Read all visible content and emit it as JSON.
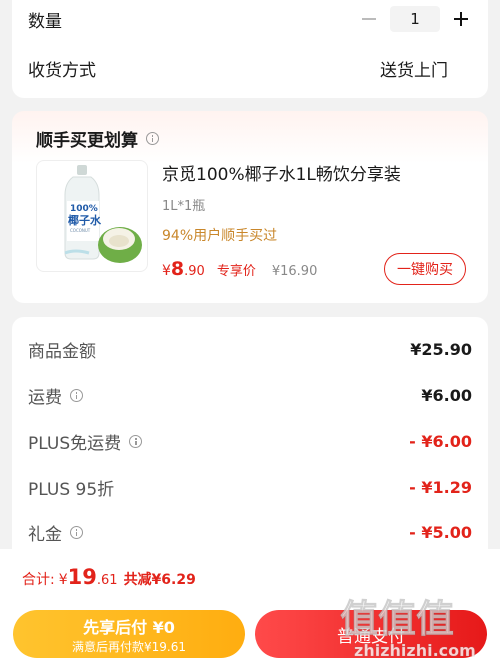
{
  "order": {
    "quantity_label": "数量",
    "quantity_value": "1",
    "delivery_label": "收货方式",
    "delivery_value": "送货上门"
  },
  "promo": {
    "title": "顺手买更划算",
    "product": {
      "name": "京觅100%椰子水1L畅饮分享装",
      "spec": "1L*1瓶",
      "rating": "94%用户顺手买过",
      "price_currency": "¥",
      "price_int": "8",
      "price_dec": ".90",
      "exclusive_label": "专享价",
      "original_price": "¥16.90",
      "buy_button": "一键购买",
      "image_label_top": "100%",
      "image_label_main": "椰子水",
      "image_label_sub": "COCONUT"
    }
  },
  "summary": {
    "rows": [
      {
        "label": "商品金额",
        "value": "¥25.90"
      },
      {
        "label": "运费",
        "value": "¥6.00"
      },
      {
        "label": "PLUS免运费",
        "value": "- ¥6.00"
      },
      {
        "label": "PLUS 95折",
        "value": "- ¥1.29"
      },
      {
        "label": "礼金",
        "value": "- ¥5.00"
      }
    ]
  },
  "bottom": {
    "total_label": "合计:",
    "total_currency": "¥",
    "total_int": "19",
    "total_dec": ".61",
    "saved": "共减¥6.29",
    "pay_later_main": "先享后付 ¥0",
    "pay_later_sub": "满意后再付款¥19.61",
    "pay_normal": "普通支付"
  },
  "watermark": {
    "text_main": "值值值",
    "text_sub": "zhizhizhi.com"
  },
  "colors": {
    "accent_red": "#e2231a",
    "gold_text": "#c9872b",
    "pay_later_yellow": "#ffb81c",
    "pay_normal_red": "#f22a2a",
    "background": "#f2f2f2"
  }
}
